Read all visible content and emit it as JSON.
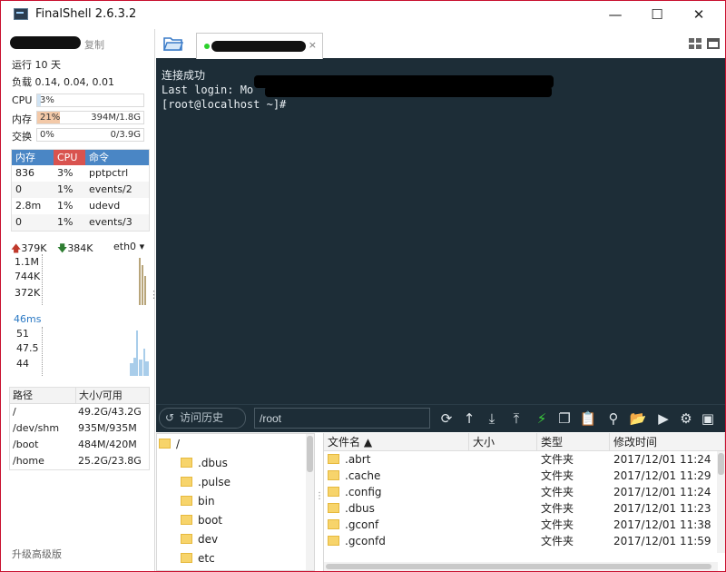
{
  "window": {
    "title": "FinalShell 2.6.3.2",
    "minimize": "—",
    "maximize": "☐",
    "close": "✕"
  },
  "left": {
    "copy": "复制",
    "uptime": "运行 10 天",
    "load": "负载 0.14, 0.04, 0.01",
    "cpu": {
      "label": "CPU",
      "percent": "3%",
      "fraction": 0.03
    },
    "mem": {
      "label": "内存",
      "percent": "21%",
      "value": "394M/1.8G",
      "fraction": 0.21
    },
    "swap": {
      "label": "交换",
      "percent": "0%",
      "value": "0/3.9G",
      "fraction": 0.0
    },
    "proc_headers": [
      "内存",
      "CPU",
      "命令"
    ],
    "processes": [
      {
        "mem": "836",
        "cpu": "3%",
        "cmd": "pptpctrl"
      },
      {
        "mem": "0",
        "cpu": "1%",
        "cmd": "events/2"
      },
      {
        "mem": "2.8m",
        "cpu": "1%",
        "cmd": "udevd"
      },
      {
        "mem": "0",
        "cpu": "1%",
        "cmd": "events/3"
      }
    ],
    "net": {
      "up": "379K",
      "down": "384K",
      "iface": "eth0",
      "scale": [
        "1.1M",
        "744K",
        "372K"
      ]
    },
    "ping": {
      "latency": "46ms",
      "scale": [
        "51",
        "47.5",
        "44"
      ]
    },
    "disk_headers": [
      "路径",
      "大小/可用"
    ],
    "disks": [
      {
        "path": "/",
        "size": "49.2G/43.2G"
      },
      {
        "path": "/dev/shm",
        "size": "935M/935M"
      },
      {
        "path": "/boot",
        "size": "484M/420M"
      },
      {
        "path": "/home",
        "size": "25.2G/23.8G"
      }
    ],
    "upgrade": "升级高级版"
  },
  "tabs": {
    "close": "×"
  },
  "terminal": {
    "lines": [
      "连接成功",
      "Last login: Mo",
      "[root@localhost ~]#"
    ]
  },
  "cmdbar": {
    "history": "访问历史",
    "path": "/root"
  },
  "tree": {
    "root": "/",
    "items": [
      ".dbus",
      ".pulse",
      "bin",
      "boot",
      "dev",
      "etc"
    ]
  },
  "files": {
    "headers": [
      "文件名 ▲",
      "大小",
      "类型",
      "修改时间"
    ],
    "rows": [
      {
        "name": ".abrt",
        "size": "",
        "type": "文件夹",
        "mtime": "2017/12/01 11:24"
      },
      {
        "name": ".cache",
        "size": "",
        "type": "文件夹",
        "mtime": "2017/12/01 11:29"
      },
      {
        "name": ".config",
        "size": "",
        "type": "文件夹",
        "mtime": "2017/12/01 11:24"
      },
      {
        "name": ".dbus",
        "size": "",
        "type": "文件夹",
        "mtime": "2017/12/01 11:23"
      },
      {
        "name": ".gconf",
        "size": "",
        "type": "文件夹",
        "mtime": "2017/12/01 11:38"
      },
      {
        "name": ".gconfd",
        "size": "",
        "type": "文件夹",
        "mtime": "2017/12/01 11:59"
      }
    ]
  },
  "colors": {
    "terminal_bg": "#1d2d37",
    "proc_mem_head": "#4a86c5",
    "proc_cpu_head": "#d9534f",
    "proc_cmd_head": "#4a86c5",
    "mem_fill": "#f3c9a8",
    "cpu_fill": "#cfe3f3",
    "net_bar": "#b8a57a",
    "ping_bar": "#a9cdea",
    "upload_arrow": "#c0392b",
    "download_arrow": "#2e7d32"
  }
}
